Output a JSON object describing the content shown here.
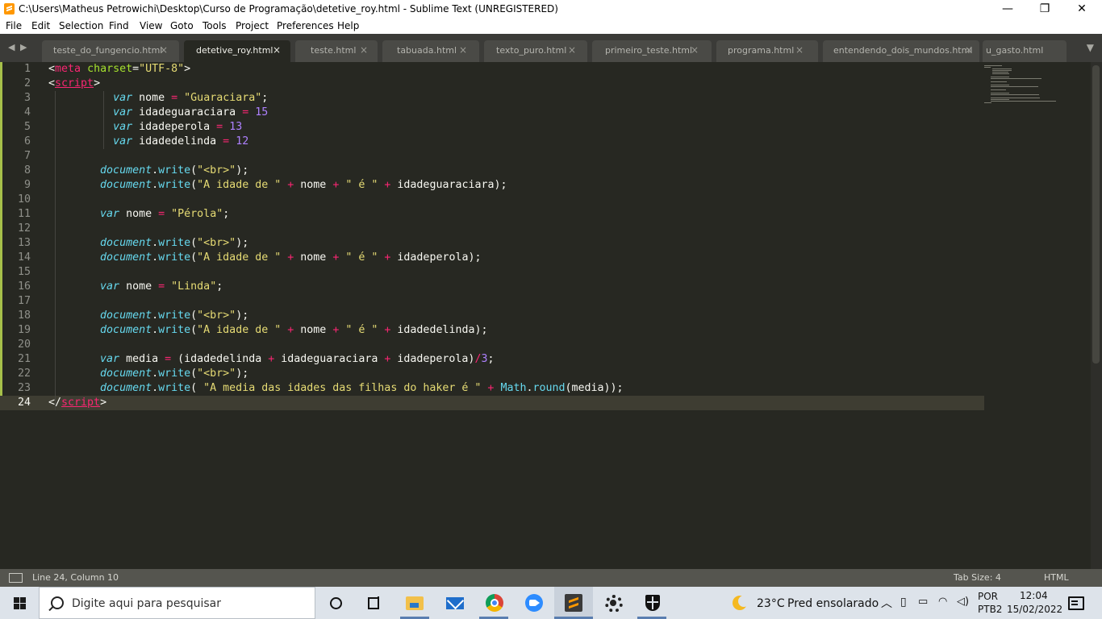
{
  "window": {
    "title": "C:\\Users\\Matheus Petrowichi\\Desktop\\Curso de Programação\\detetive_roy.html - Sublime Text (UNREGISTERED)",
    "minimize_glyph": "—",
    "maximize_glyph": "❐",
    "close_glyph": "✕"
  },
  "menu": [
    "File",
    "Edit",
    "Selection",
    "Find",
    "View",
    "Goto",
    "Tools",
    "Project",
    "Preferences",
    "Help"
  ],
  "tabs": [
    {
      "label": "teste_do_fungencio.html",
      "active": false
    },
    {
      "label": "detetive_roy.html",
      "active": true
    },
    {
      "label": "teste.html",
      "active": false
    },
    {
      "label": "tabuada.html",
      "active": false
    },
    {
      "label": "texto_puro.html",
      "active": false
    },
    {
      "label": "primeiro_teste.html",
      "active": false
    },
    {
      "label": "programa.html",
      "active": false
    },
    {
      "label": "entendendo_dois_mundos.html",
      "active": false
    },
    {
      "label": "u_gasto.html",
      "active": false
    }
  ],
  "tab_close_glyph": "×",
  "tab_nav_left": "◀",
  "tab_nav_right": "▶",
  "tab_dropdown_glyph": "▼",
  "editor": {
    "current_line": 24,
    "lines": [
      [
        [
          "<",
          "t-punc"
        ],
        [
          "meta",
          "t-tag"
        ],
        [
          " ",
          "t-pl"
        ],
        [
          "charset",
          "t-attr"
        ],
        [
          "=",
          "t-punc"
        ],
        [
          "\"UTF-8\"",
          "t-str"
        ],
        [
          ">",
          "t-punc"
        ]
      ],
      [
        [
          "<",
          "t-punc"
        ],
        [
          "script",
          "t-tag t-underline"
        ],
        [
          ">",
          "t-punc"
        ]
      ],
      [
        [
          "          ",
          "t-pl"
        ],
        [
          "var",
          "t-kw"
        ],
        [
          " nome ",
          "t-pl"
        ],
        [
          "=",
          "t-op"
        ],
        [
          " ",
          "t-pl"
        ],
        [
          "\"Guaraciara\"",
          "t-str"
        ],
        [
          ";",
          "t-pl"
        ]
      ],
      [
        [
          "          ",
          "t-pl"
        ],
        [
          "var",
          "t-kw"
        ],
        [
          " idadeguaraciara ",
          "t-pl"
        ],
        [
          "=",
          "t-op"
        ],
        [
          " ",
          "t-pl"
        ],
        [
          "15",
          "t-num"
        ]
      ],
      [
        [
          "          ",
          "t-pl"
        ],
        [
          "var",
          "t-kw"
        ],
        [
          " idadeperola ",
          "t-pl"
        ],
        [
          "=",
          "t-op"
        ],
        [
          " ",
          "t-pl"
        ],
        [
          "13",
          "t-num"
        ]
      ],
      [
        [
          "          ",
          "t-pl"
        ],
        [
          "var",
          "t-kw"
        ],
        [
          " idadedelinda ",
          "t-pl"
        ],
        [
          "=",
          "t-op"
        ],
        [
          " ",
          "t-pl"
        ],
        [
          "12",
          "t-num"
        ]
      ],
      [],
      [
        [
          "        ",
          "t-pl"
        ],
        [
          "document",
          "t-kw"
        ],
        [
          ".",
          "t-pl"
        ],
        [
          "write",
          "t-fn"
        ],
        [
          "(",
          "t-pl"
        ],
        [
          "\"<br>\"",
          "t-str"
        ],
        [
          ");",
          "t-pl"
        ]
      ],
      [
        [
          "        ",
          "t-pl"
        ],
        [
          "document",
          "t-kw"
        ],
        [
          ".",
          "t-pl"
        ],
        [
          "write",
          "t-fn"
        ],
        [
          "(",
          "t-pl"
        ],
        [
          "\"A idade de \"",
          "t-str"
        ],
        [
          " ",
          "t-pl"
        ],
        [
          "+",
          "t-op"
        ],
        [
          " nome ",
          "t-pl"
        ],
        [
          "+",
          "t-op"
        ],
        [
          " ",
          "t-pl"
        ],
        [
          "\" é \"",
          "t-str"
        ],
        [
          " ",
          "t-pl"
        ],
        [
          "+",
          "t-op"
        ],
        [
          " idadeguaraciara);",
          "t-pl"
        ]
      ],
      [],
      [
        [
          "        ",
          "t-pl"
        ],
        [
          "var",
          "t-kw"
        ],
        [
          " nome ",
          "t-pl"
        ],
        [
          "=",
          "t-op"
        ],
        [
          " ",
          "t-pl"
        ],
        [
          "\"Pérola\"",
          "t-str"
        ],
        [
          ";",
          "t-pl"
        ]
      ],
      [],
      [
        [
          "        ",
          "t-pl"
        ],
        [
          "document",
          "t-kw"
        ],
        [
          ".",
          "t-pl"
        ],
        [
          "write",
          "t-fn"
        ],
        [
          "(",
          "t-pl"
        ],
        [
          "\"<br>\"",
          "t-str"
        ],
        [
          ");",
          "t-pl"
        ]
      ],
      [
        [
          "        ",
          "t-pl"
        ],
        [
          "document",
          "t-kw"
        ],
        [
          ".",
          "t-pl"
        ],
        [
          "write",
          "t-fn"
        ],
        [
          "(",
          "t-pl"
        ],
        [
          "\"A idade de \"",
          "t-str"
        ],
        [
          " ",
          "t-pl"
        ],
        [
          "+",
          "t-op"
        ],
        [
          " nome ",
          "t-pl"
        ],
        [
          "+",
          "t-op"
        ],
        [
          " ",
          "t-pl"
        ],
        [
          "\" é \"",
          "t-str"
        ],
        [
          " ",
          "t-pl"
        ],
        [
          "+",
          "t-op"
        ],
        [
          " idadeperola);",
          "t-pl"
        ]
      ],
      [],
      [
        [
          "        ",
          "t-pl"
        ],
        [
          "var",
          "t-kw"
        ],
        [
          " nome ",
          "t-pl"
        ],
        [
          "=",
          "t-op"
        ],
        [
          " ",
          "t-pl"
        ],
        [
          "\"Linda\"",
          "t-str"
        ],
        [
          ";",
          "t-pl"
        ]
      ],
      [],
      [
        [
          "        ",
          "t-pl"
        ],
        [
          "document",
          "t-kw"
        ],
        [
          ".",
          "t-pl"
        ],
        [
          "write",
          "t-fn"
        ],
        [
          "(",
          "t-pl"
        ],
        [
          "\"<br>\"",
          "t-str"
        ],
        [
          ");",
          "t-pl"
        ]
      ],
      [
        [
          "        ",
          "t-pl"
        ],
        [
          "document",
          "t-kw"
        ],
        [
          ".",
          "t-pl"
        ],
        [
          "write",
          "t-fn"
        ],
        [
          "(",
          "t-pl"
        ],
        [
          "\"A idade de \"",
          "t-str"
        ],
        [
          " ",
          "t-pl"
        ],
        [
          "+",
          "t-op"
        ],
        [
          " nome ",
          "t-pl"
        ],
        [
          "+",
          "t-op"
        ],
        [
          " ",
          "t-pl"
        ],
        [
          "\" é \"",
          "t-str"
        ],
        [
          " ",
          "t-pl"
        ],
        [
          "+",
          "t-op"
        ],
        [
          " idadedelinda);",
          "t-pl"
        ]
      ],
      [],
      [
        [
          "        ",
          "t-pl"
        ],
        [
          "var",
          "t-kw"
        ],
        [
          " media ",
          "t-pl"
        ],
        [
          "=",
          "t-op"
        ],
        [
          " (idadedelinda ",
          "t-pl"
        ],
        [
          "+",
          "t-op"
        ],
        [
          " idadeguaraciara ",
          "t-pl"
        ],
        [
          "+",
          "t-op"
        ],
        [
          " idadeperola)",
          "t-pl"
        ],
        [
          "/",
          "t-op"
        ],
        [
          "3",
          "t-num"
        ],
        [
          ";",
          "t-pl"
        ]
      ],
      [
        [
          "        ",
          "t-pl"
        ],
        [
          "document",
          "t-kw"
        ],
        [
          ".",
          "t-pl"
        ],
        [
          "write",
          "t-fn"
        ],
        [
          "(",
          "t-pl"
        ],
        [
          "\"<br>\"",
          "t-str"
        ],
        [
          ");",
          "t-pl"
        ]
      ],
      [
        [
          "        ",
          "t-pl"
        ],
        [
          "document",
          "t-kw"
        ],
        [
          ".",
          "t-pl"
        ],
        [
          "write",
          "t-fn"
        ],
        [
          "( ",
          "t-pl"
        ],
        [
          "\"A media das idades das filhas do haker é \"",
          "t-str"
        ],
        [
          " ",
          "t-pl"
        ],
        [
          "+",
          "t-op"
        ],
        [
          " ",
          "t-pl"
        ],
        [
          "Math",
          "t-fn"
        ],
        [
          ".",
          "t-pl"
        ],
        [
          "round",
          "t-fn"
        ],
        [
          "(media));",
          "t-pl"
        ]
      ],
      [
        [
          "</",
          "t-punc"
        ],
        [
          "script",
          "t-tag t-underline"
        ],
        [
          ">",
          "t-punc"
        ]
      ]
    ]
  },
  "status": {
    "position": "Line 24, Column 10",
    "tab_size": "Tab Size: 4",
    "syntax": "HTML"
  },
  "taskbar": {
    "search_placeholder": "Digite aqui para pesquisar",
    "weather_temp": "23°C",
    "weather_text": "Pred ensolarado",
    "lang_top": "POR",
    "lang_bottom": "PTB2",
    "time": "12:04",
    "date": "15/02/2022"
  },
  "colors": {
    "editor_bg": "#272822",
    "keyword": "#66d9ef",
    "string": "#e6db74",
    "number": "#ae81ff",
    "tag": "#f92672",
    "attr": "#a6e22e"
  }
}
